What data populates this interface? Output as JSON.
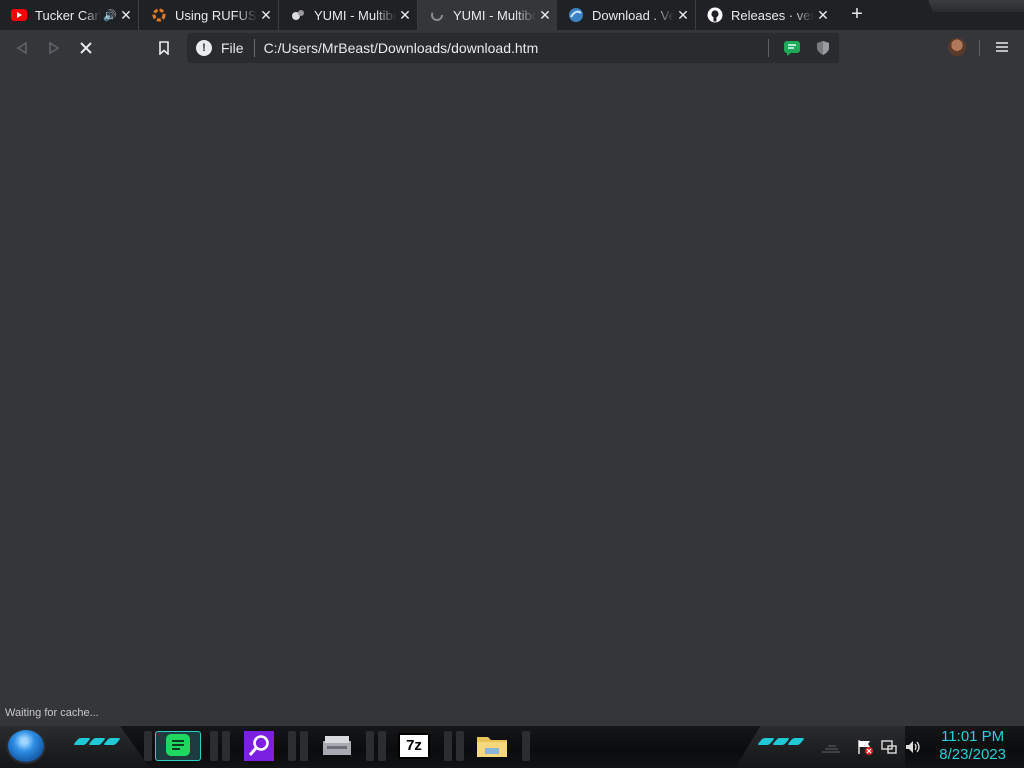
{
  "tabs": [
    {
      "title": "Tucker Carlson",
      "icon": "youtube-icon",
      "audio": true
    },
    {
      "title": "Using RUFUS on",
      "icon": "rufus-icon"
    },
    {
      "title": "YUMI - Multiboot",
      "icon": "yumi-icon"
    },
    {
      "title": "YUMI - Multiboot",
      "icon": "loading-icon",
      "active": true
    },
    {
      "title": "Download . Ventoy",
      "icon": "ventoy-icon"
    },
    {
      "title": "Releases · ventoy",
      "icon": "github-icon"
    }
  ],
  "omnibox": {
    "scheme_label": "File",
    "url": "C:/Users/MrBeast/Downloads/download.htm"
  },
  "status_text": "Waiting for cache...",
  "taskbar": {
    "apps": [
      {
        "name": "spotify",
        "label": ""
      },
      {
        "name": "search-everything",
        "label": ""
      },
      {
        "name": "disk-utility",
        "label": ""
      },
      {
        "name": "7zip",
        "label": "7z"
      },
      {
        "name": "file-explorer",
        "label": ""
      }
    ],
    "time": "11:01 PM",
    "date": "8/23/2023"
  },
  "colors": {
    "accent_cyan": "#26d0dc",
    "spotify_green": "#1ed760",
    "chrome_dark": "#202124",
    "page_bg": "#35363a"
  }
}
